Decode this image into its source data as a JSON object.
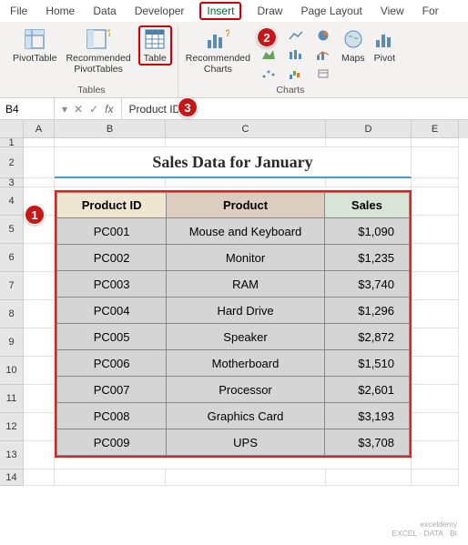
{
  "menu": {
    "items": [
      "File",
      "Home",
      "Data",
      "Developer",
      "Insert",
      "Draw",
      "Page Layout",
      "View",
      "For"
    ],
    "active_index": 4
  },
  "ribbon": {
    "tables": {
      "pivot": "PivotTable",
      "recpivot": "Recommended\nPivotTables",
      "table": "Table",
      "group_label": "Tables"
    },
    "charts": {
      "rec": "Recommended\nCharts",
      "maps": "Maps",
      "pivotc": "Pivot",
      "group_label": "Charts"
    }
  },
  "namebox": {
    "ref": "B4",
    "formula": "Product ID"
  },
  "columns": [
    "A",
    "B",
    "C",
    "D",
    "E"
  ],
  "row_numbers": [
    "1",
    "2",
    "3",
    "4",
    "5",
    "6",
    "7",
    "8",
    "9",
    "10",
    "11",
    "12",
    "13",
    "14"
  ],
  "title": "Sales Data for January",
  "headers": {
    "pid": "Product ID",
    "product": "Product",
    "sales": "Sales"
  },
  "chart_data": {
    "type": "table",
    "columns": [
      "Product ID",
      "Product",
      "Sales"
    ],
    "rows": [
      {
        "pid": "PC001",
        "product": "Mouse and Keyboard",
        "sales": "$1,090"
      },
      {
        "pid": "PC002",
        "product": "Monitor",
        "sales": "$1,235"
      },
      {
        "pid": "PC003",
        "product": "RAM",
        "sales": "$3,740"
      },
      {
        "pid": "PC004",
        "product": "Hard Drive",
        "sales": "$1,296"
      },
      {
        "pid": "PC005",
        "product": "Speaker",
        "sales": "$2,872"
      },
      {
        "pid": "PC006",
        "product": "Motherboard",
        "sales": "$1,510"
      },
      {
        "pid": "PC007",
        "product": "Processor",
        "sales": "$2,601"
      },
      {
        "pid": "PC008",
        "product": "Graphics Card",
        "sales": "$3,193"
      },
      {
        "pid": "PC009",
        "product": "UPS",
        "sales": "$3,708"
      }
    ]
  },
  "callouts": {
    "c1": "1",
    "c2": "2",
    "c3": "3"
  },
  "watermark": {
    "l1": "exceldemy",
    "l2": "EXCEL · DATA · BI"
  }
}
